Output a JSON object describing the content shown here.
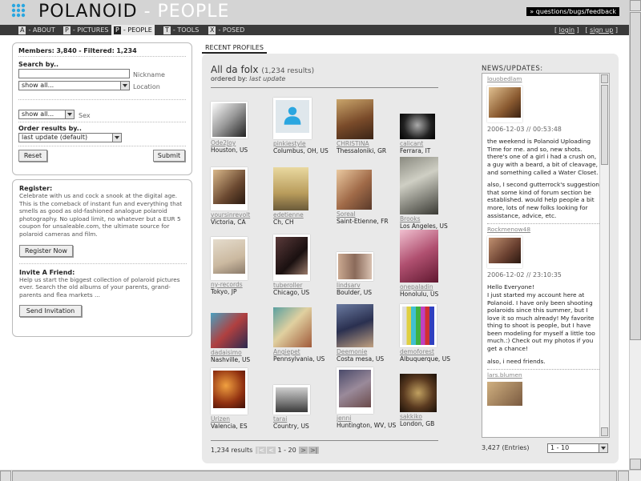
{
  "header": {
    "brand": "POLANOID",
    "section": " - PEOPLE",
    "feedback_link": "» questions/bugs/feedback"
  },
  "nav": {
    "tabs": [
      {
        "key": "A",
        "label": "- ABOUT"
      },
      {
        "key": "P",
        "label": "- PICTURES"
      },
      {
        "key": "P",
        "label": "- PEOPLE"
      },
      {
        "key": "T",
        "label": "- TOOLS"
      },
      {
        "key": "X",
        "label": "- POSED"
      }
    ],
    "login": "login",
    "signup": "sign up"
  },
  "search": {
    "members_label": "Members:",
    "members_value": "3,840",
    "filtered_label": "- Filtered:",
    "filtered_value": "1,234",
    "search_by": "Search by..",
    "nickname_label": "Nickname",
    "location_label": "Location",
    "location_value": "show all...",
    "sex_value": "show all...",
    "sex_label": "Sex",
    "order_label": "Order results by..",
    "order_value": "last update (default)",
    "reset": "Reset",
    "submit": "Submit"
  },
  "register": {
    "title": "Register:",
    "text": "Celebrate with us and cock a snook at the digital age. This is the comeback of instant fun and everything that smells as good as old-fashioned analogue polaroid photography. No upload limit, no whatever but a EUR 5 coupon for unsaleable.com, the ultimate source for polaroid cameras and film.",
    "button": "Register Now",
    "invite_title": "Invite A Friend:",
    "invite_text": "Help us start the biggest collection of polaroid pictures ever. Search the old albums of your parents, grand-parents and flea markets ...",
    "invite_button": "Send Invitation"
  },
  "main": {
    "tab": "RECENT PROFILES",
    "heading": "All da folx",
    "count": "(1,234 results)",
    "ordered_by": "ordered by:",
    "ordered_value": "last update",
    "profiles": [
      {
        "name": "Ode2Joy",
        "location": "Houston, US"
      },
      {
        "name": "pinkiestyle",
        "location": "Columbus, OH, US"
      },
      {
        "name": "CHRISTINA",
        "location": "Thessaloniki, GR"
      },
      {
        "name": "calicant",
        "location": "Ferrara, IT"
      },
      {
        "name": "voursinrevolt",
        "location": "Victoria, CA"
      },
      {
        "name": "edetienne",
        "location": "Ch, CH"
      },
      {
        "name": "Soreal",
        "location": "Saint-Etienne, FR"
      },
      {
        "name": "Brooks",
        "location": "Los Angeles, US"
      },
      {
        "name": "ny-records",
        "location": "Tokyo, JP"
      },
      {
        "name": "tuberoller",
        "location": "Chicago, US"
      },
      {
        "name": "lindsarv",
        "location": "Boulder, US"
      },
      {
        "name": "onepaladin",
        "location": "Honolulu, US"
      },
      {
        "name": "dadaisimo",
        "location": "Nashville, US"
      },
      {
        "name": "Angiepet",
        "location": "Pennsylvania, US"
      },
      {
        "name": "Deemonie",
        "location": "Costa mesa, US"
      },
      {
        "name": "demoforest",
        "location": "Albuquerque, US"
      },
      {
        "name": "Urizen",
        "location": "Valencia, ES"
      },
      {
        "name": "tarai",
        "location": "Country, US"
      },
      {
        "name": "jenni",
        "location": "Huntington, WV, US"
      },
      {
        "name": "sakkiko",
        "location": "London, GB"
      }
    ],
    "pager": {
      "results": "1,234 results",
      "range": "1 - 20"
    }
  },
  "news": {
    "title": "NEWS/UPDATES:",
    "posts": [
      {
        "user": "louobedlam",
        "date": "2006-12-03 // 00:53:48",
        "text": "the weekend is Polanoid Uploading Time for me. and so, new shots. there's one of a girl i had a crush on, a guy with a beard, a bit of cleavage, and something called a Water Closet.",
        "text2": "also, I second gutterrock's suggestion that some kind of forum section be established. would help people a bit more, lots of new folks looking for assistance, advice, etc."
      },
      {
        "user": "Rockmenow48",
        "date": "2006-12-02 // 23:10:35",
        "text": "Hello Everyone!\nI just started my account here at Polanoid. I have only been shooting polaroids since this summer, but I love it so much already! My favorite thing to shoot is people, but I have been modeling for myself a little too much.:) Check out my photos if you get a chance!",
        "text2": "also, i need friends."
      },
      {
        "user": "lars.blumen"
      }
    ],
    "entries": "3,427 (Entries)",
    "page_select": "1 - 10"
  }
}
